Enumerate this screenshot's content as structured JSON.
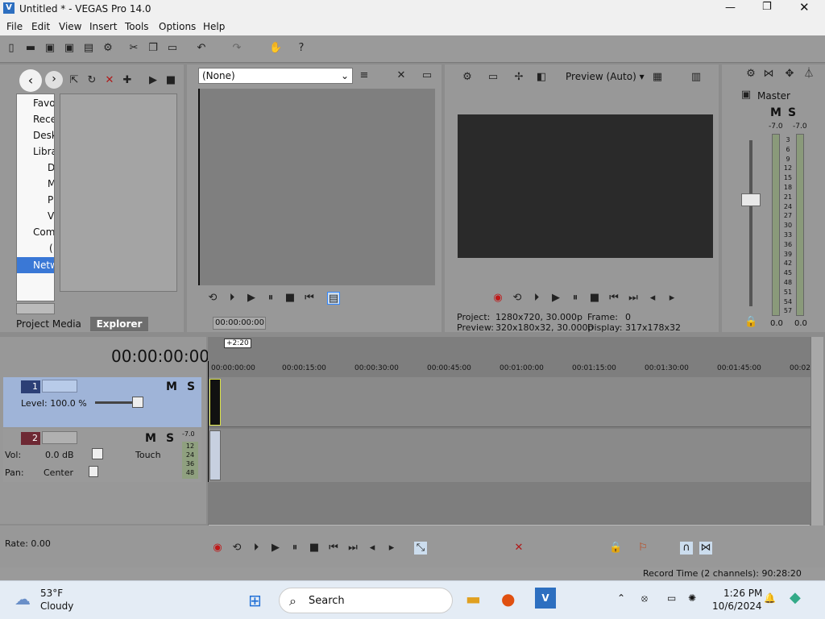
{
  "window": {
    "title": "Untitled * - VEGAS Pro 14.0"
  },
  "menu": [
    "File",
    "Edit",
    "View",
    "Insert",
    "Tools",
    "Options",
    "Help"
  ],
  "explorer": {
    "tree": [
      "Favor",
      "Recer",
      "Deskt",
      "Libra",
      "D",
      "M",
      "P",
      "V",
      "Comp",
      "(",
      "Netw"
    ],
    "tabs": [
      "Project Media",
      "Explorer"
    ]
  },
  "trimmer": {
    "selector": "(None)",
    "timecode": "00:00:00:00"
  },
  "preview": {
    "mode": "Preview (Auto)",
    "project_label": "Project:",
    "project_value": "1280x720, 30.000p",
    "preview_label": "Preview:",
    "preview_value": "320x180x32, 30.000p",
    "frame_label": "Frame:",
    "frame_value": "0",
    "display_label": "Display:",
    "display_value": "317x178x32"
  },
  "master": {
    "title": "Master",
    "m": "M",
    "s": "S",
    "peak_l": "-7.0",
    "peak_r": "-7.0",
    "scale": [
      "3",
      "6",
      "9",
      "12",
      "15",
      "18",
      "21",
      "24",
      "27",
      "30",
      "33",
      "36",
      "39",
      "42",
      "45",
      "48",
      "51",
      "54",
      "57"
    ],
    "bottom_l": "0.0",
    "bottom_r": "0.0"
  },
  "timeline": {
    "timecode": "00:00:00:00",
    "marker": "+2:20",
    "ruler": [
      "00:00:00:00",
      "00:00:15:00",
      "00:00:30:00",
      "00:00:45:00",
      "00:01:00:00",
      "00:01:15:00",
      "00:01:30:00",
      "00:01:45:00",
      "00:02"
    ]
  },
  "tracks": [
    {
      "num": "1",
      "m": "M",
      "s": "S",
      "level": "Level: 100.0 %"
    },
    {
      "num": "2",
      "m": "M",
      "s": "S",
      "vol_label": "Vol:",
      "vol_value": "0.0 dB",
      "pan_label": "Pan:",
      "pan_value": "Center",
      "automation": "Touch",
      "peak": "-7.0",
      "meter": [
        "12",
        "24",
        "36",
        "48"
      ]
    }
  ],
  "transport": {
    "rate": "Rate: 0.00",
    "record_time": "Record Time (2 channels): 90:28:20"
  },
  "taskbar": {
    "temp": "53°F",
    "weather": "Cloudy",
    "search": "Search",
    "time": "1:26 PM",
    "date": "10/6/2024"
  }
}
